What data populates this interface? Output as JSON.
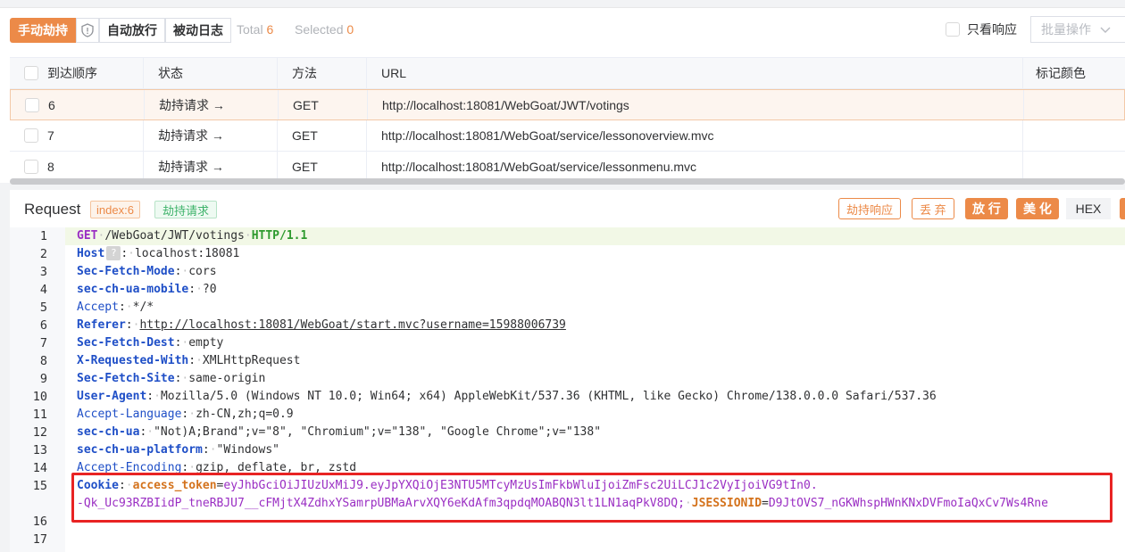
{
  "toolbar": {
    "intercept_label": "手动劫持",
    "auto_label": "自动放行",
    "log_label": "被动日志",
    "total_label": "Total",
    "total_value": "6",
    "selected_label": "Selected",
    "selected_value": "0",
    "only_response_label": "只看响应",
    "batch_label": "批量操作"
  },
  "table": {
    "columns": [
      "到达顺序",
      "状态",
      "方法",
      "URL",
      "标记颜色"
    ],
    "rows": [
      {
        "order": "6",
        "status": "劫持请求 →",
        "method": "GET",
        "url": "http://localhost:18081/WebGoat/JWT/votings"
      },
      {
        "order": "7",
        "status": "劫持请求 →",
        "method": "GET",
        "url": "http://localhost:18081/WebGoat/service/lessonoverview.mvc"
      },
      {
        "order": "8",
        "status": "劫持请求 →",
        "method": "GET",
        "url": "http://localhost:18081/WebGoat/service/lessonmenu.mvc"
      }
    ]
  },
  "request": {
    "title": "Request",
    "index_tag": "index:6",
    "state_tag": "劫持请求",
    "actions": {
      "hijack_response": "劫持响应",
      "drop": "丢 弃",
      "forward": "放 行",
      "beautify": "美 化",
      "hex": "HEX"
    }
  },
  "editor": {
    "l1": {
      "method": "GET",
      "path": "/WebGoat/JWT/votings",
      "proto": "HTTP/1.1"
    },
    "l2": {
      "name": "Host",
      "help": "?",
      "value": "localhost:18081"
    },
    "l3": {
      "name": "Sec-Fetch-Mode",
      "value": "cors"
    },
    "l4": {
      "name": "sec-ch-ua-mobile",
      "value": "?0"
    },
    "l5": {
      "name": "Accept",
      "value": "*/*"
    },
    "l6": {
      "name": "Referer",
      "value": "http://localhost:18081/WebGoat/start.mvc?username=15988006739"
    },
    "l7": {
      "name": "Sec-Fetch-Dest",
      "value": "empty"
    },
    "l8": {
      "name": "X-Requested-With",
      "value": "XMLHttpRequest"
    },
    "l9": {
      "name": "Sec-Fetch-Site",
      "value": "same-origin"
    },
    "l10": {
      "name": "User-Agent",
      "value": "Mozilla/5.0 (Windows NT 10.0; Win64; x64) AppleWebKit/537.36 (KHTML, like Gecko) Chrome/138.0.0.0 Safari/537.36"
    },
    "l11": {
      "name": "Accept-Language",
      "value": "zh-CN,zh;q=0.9"
    },
    "l12": {
      "name": "sec-ch-ua",
      "value": "\"Not)A;Brand\";v=\"8\", \"Chromium\";v=\"138\", \"Google Chrome\";v=\"138\""
    },
    "l13": {
      "name": "sec-ch-ua-platform",
      "value": "\"Windows\""
    },
    "l14": {
      "name": "Accept-Encoding",
      "value": "gzip, deflate, br, zstd"
    },
    "l15": {
      "name": "Cookie",
      "token_name": "access_token",
      "token_value_1": "eyJhbGciOiJIUzUxMiJ9.eyJpYXQiOjE3NTU5MTcyMzUsImFkbWluIjoiZmFsc2UiLCJ1c2VyIjoiVG9tIn0.",
      "token_value_2": "-Qk_Uc93RZBIidP_tneRBJU7__cFMjtX4ZdhxYSamrpUBMaArvXQY6eKdAfm3qpdqMOABQN3lt1LN1aqPkV8DQ;",
      "session_name": "JSESSIONID",
      "session_value": "D9JtOVS7_nGKWhspHWnKNxDVFmoIaQxCv7Ws4Rne"
    },
    "line_numbers": [
      "1",
      "2",
      "3",
      "4",
      "5",
      "6",
      "7",
      "8",
      "9",
      "10",
      "11",
      "12",
      "13",
      "14",
      "15",
      "16",
      "17"
    ]
  }
}
